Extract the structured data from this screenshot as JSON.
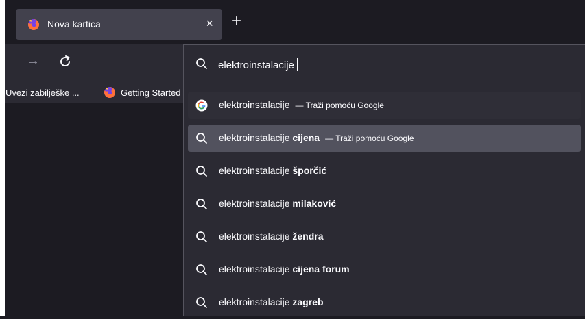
{
  "tab": {
    "title": "Nova kartica",
    "close_glyph": "×"
  },
  "new_tab_glyph": "+",
  "nav": {
    "back_glyph": "→"
  },
  "bookmarks": {
    "items": [
      {
        "label": "Uvezi zabilješke ..."
      },
      {
        "label": "Getting Started"
      }
    ]
  },
  "urlbar": {
    "value": "elektroinstalacije"
  },
  "suggestions": [
    {
      "base": "elektroinstalacije",
      "bold": "",
      "action": "— Traži pomoću Google",
      "icon": "google-icon",
      "state": "selected"
    },
    {
      "base": "elektroinstalacije ",
      "bold": "cijena",
      "action": "— Traži pomoću Google",
      "icon": "search-icon",
      "state": "hover"
    },
    {
      "base": "elektroinstalacije ",
      "bold": "šporčić",
      "action": "",
      "icon": "search-icon",
      "state": ""
    },
    {
      "base": "elektroinstalacije ",
      "bold": "milaković",
      "action": "",
      "icon": "search-icon",
      "state": ""
    },
    {
      "base": "elektroinstalacije ",
      "bold": "žendra",
      "action": "",
      "icon": "search-icon",
      "state": ""
    },
    {
      "base": "elektroinstalacije ",
      "bold": "cijena forum",
      "action": "",
      "icon": "search-icon",
      "state": ""
    },
    {
      "base": "elektroinstalacije ",
      "bold": "zagreb",
      "action": "",
      "icon": "search-icon",
      "state": ""
    }
  ],
  "colors": {
    "background": "#1c1b22",
    "toolbar": "#2b2a33",
    "tab": "#42414d",
    "highlight": "#52525e"
  }
}
